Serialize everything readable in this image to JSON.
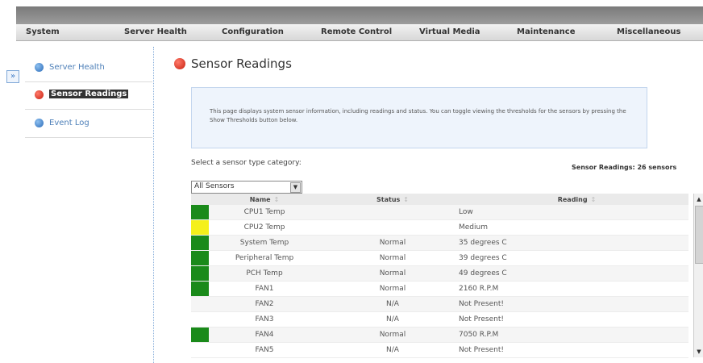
{
  "nav": [
    "System",
    "Server Health",
    "Configuration",
    "Remote Control",
    "Virtual Media",
    "Maintenance",
    "Miscellaneous"
  ],
  "sidebar": {
    "items": [
      {
        "label": "Server Health",
        "active": false
      },
      {
        "label": "Sensor Readings",
        "active": true
      },
      {
        "label": "Event Log",
        "active": false
      }
    ]
  },
  "main": {
    "title": "Sensor Readings",
    "info": "This page displays system sensor information, including readings and status. You can toggle viewing the thresholds for the sensors by pressing the Show Thresholds button below.",
    "select_label": "Select a sensor type category:",
    "select_value": "All Sensors",
    "count_label": "Sensor Readings: 26 sensors"
  },
  "table": {
    "headers": {
      "name": "Name",
      "status": "Status",
      "reading": "Reading"
    },
    "rows": [
      {
        "color": "green",
        "name": "CPU1 Temp",
        "status": "",
        "reading": "Low"
      },
      {
        "color": "yellow",
        "name": "CPU2 Temp",
        "status": "",
        "reading": "Medium"
      },
      {
        "color": "green",
        "name": "System Temp",
        "status": "Normal",
        "reading": "35 degrees C"
      },
      {
        "color": "green",
        "name": "Peripheral Temp",
        "status": "Normal",
        "reading": "39 degrees C"
      },
      {
        "color": "green",
        "name": "PCH Temp",
        "status": "Normal",
        "reading": "49 degrees C"
      },
      {
        "color": "green",
        "name": "FAN1",
        "status": "Normal",
        "reading": "2160 R.P.M"
      },
      {
        "color": "none",
        "name": "FAN2",
        "status": "N/A",
        "reading": "Not Present!"
      },
      {
        "color": "none",
        "name": "FAN3",
        "status": "N/A",
        "reading": "Not Present!"
      },
      {
        "color": "green",
        "name": "FAN4",
        "status": "Normal",
        "reading": "7050 R.P.M"
      },
      {
        "color": "none",
        "name": "FAN5",
        "status": "N/A",
        "reading": "Not Present!"
      }
    ]
  },
  "colors": {
    "ok": "#1a8a1a",
    "warn": "#f5f01a",
    "accent": "#c8200f",
    "link": "#4d7fb8"
  }
}
